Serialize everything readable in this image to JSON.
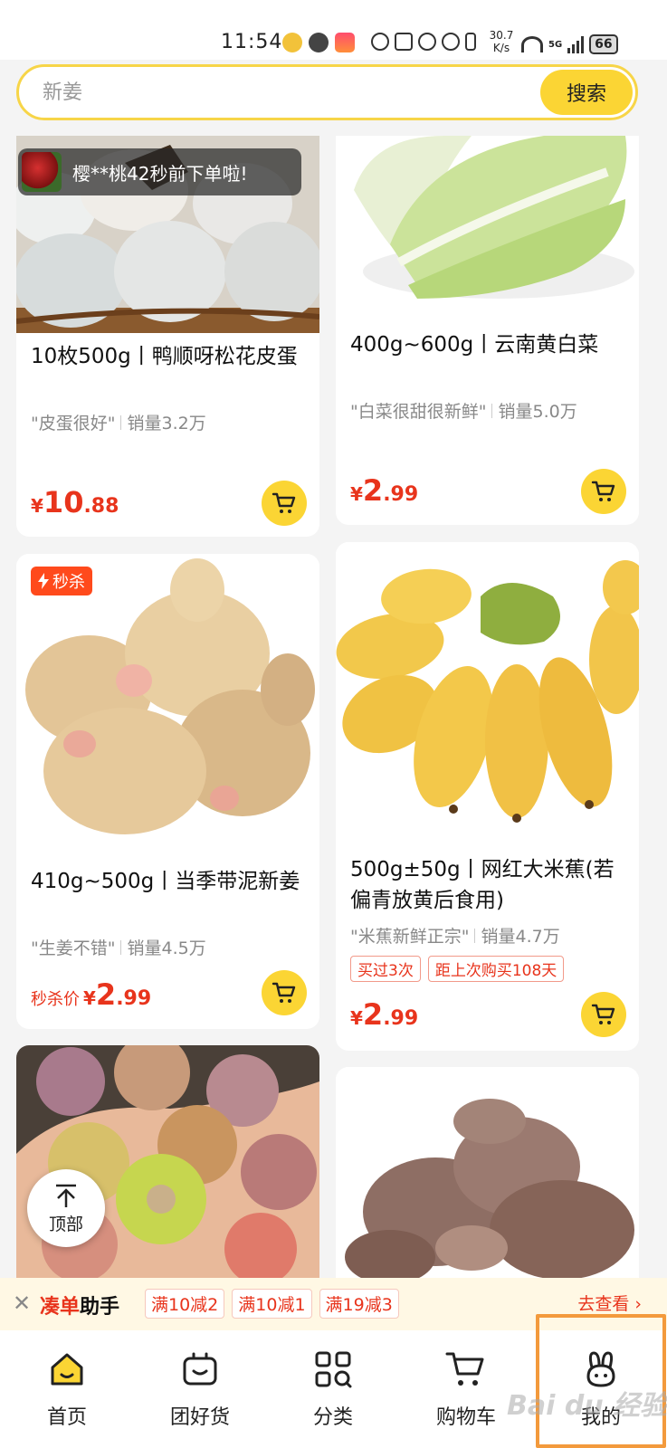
{
  "status_bar": {
    "time": "11:54",
    "net_speed": "30.7",
    "net_unit": "K/s",
    "network": "5G",
    "battery": "66"
  },
  "search": {
    "placeholder": "新姜",
    "button_label": "搜索"
  },
  "toast": {
    "text": "樱**桃42秒前下单啦!"
  },
  "products": [
    {
      "title": "10枚500g丨鸭顺呀松花皮蛋",
      "review": "\"皮蛋很好\"",
      "sales": "销量3.2万",
      "currency": "¥",
      "price_int": "10",
      "price_dec": ".88"
    },
    {
      "title": "400g~600g丨云南黄白菜",
      "review": "\"白菜很甜很新鲜\"",
      "sales": "销量5.0万",
      "currency": "¥",
      "price_int": "2",
      "price_dec": ".99"
    },
    {
      "badge": "秒杀",
      "title": "410g~500g丨当季带泥新姜",
      "review": "\"生姜不错\"",
      "sales": "销量4.5万",
      "price_label": "秒杀价",
      "currency": "¥",
      "price_int": "2",
      "price_dec": ".99"
    },
    {
      "title": "500g±50g丨网红大米蕉(若偏青放黄后食用)",
      "review": "\"米蕉新鲜正宗\"",
      "sales": "销量4.7万",
      "tags": [
        "买过3次",
        "距上次购买108天"
      ],
      "currency": "¥",
      "price_int": "2",
      "price_dec": ".99"
    }
  ],
  "back_to_top": {
    "label": "顶部"
  },
  "order_helper": {
    "title_highlight": "凑单",
    "title_rest": "助手",
    "coupons": [
      "满10减2",
      "满10减1",
      "满19减3"
    ],
    "go_label": "去查看"
  },
  "bottom_nav": [
    {
      "label": "首页",
      "icon": "home-icon",
      "active": true
    },
    {
      "label": "团好货",
      "icon": "gift-box-icon"
    },
    {
      "label": "分类",
      "icon": "category-grid-icon"
    },
    {
      "label": "购物车",
      "icon": "cart-icon"
    },
    {
      "label": "我的",
      "icon": "bunny-profile-icon"
    }
  ],
  "watermark": "Bai du 经验",
  "colors": {
    "accent_yellow": "#fbd534",
    "price_red": "#e8341c",
    "highlight_orange": "#f39a3c"
  }
}
